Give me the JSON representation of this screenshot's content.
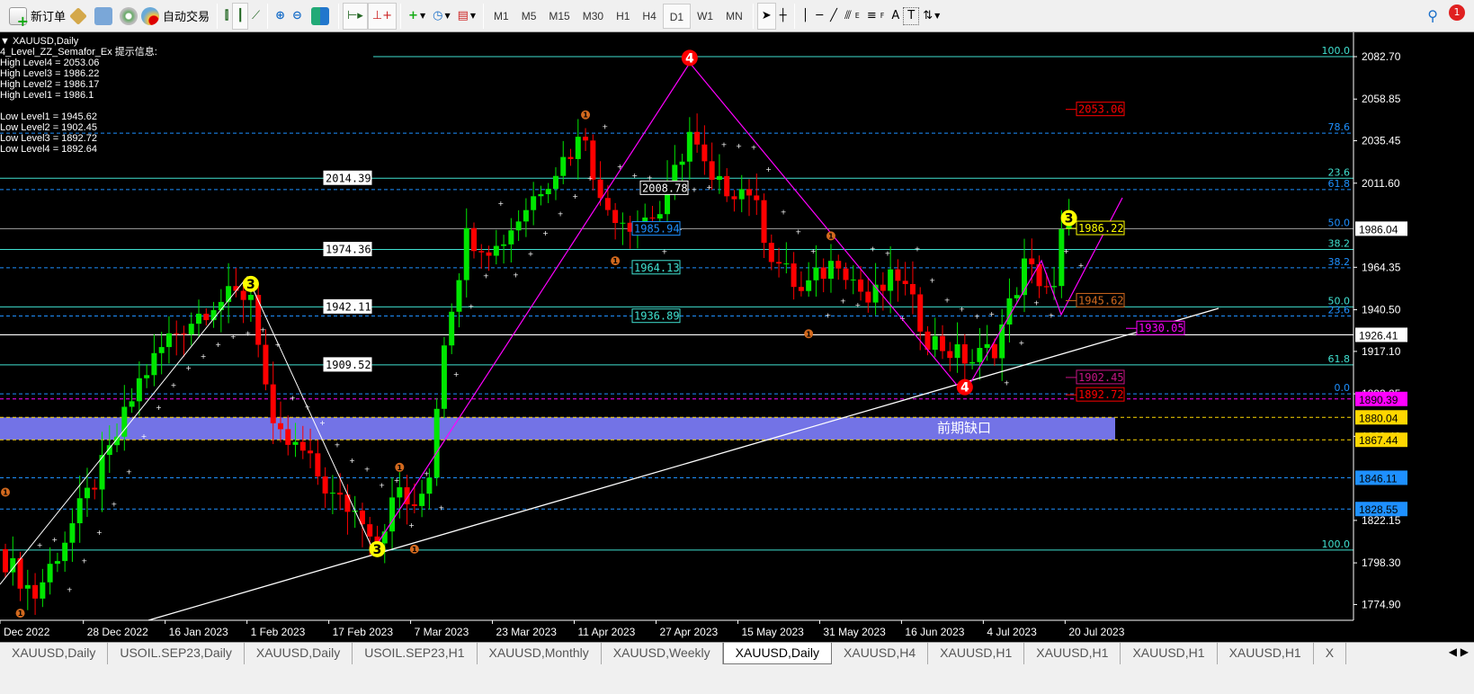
{
  "toolbar": {
    "new_order": "新订单",
    "auto_trading": "自动交易",
    "timeframes": [
      "M1",
      "M5",
      "M15",
      "M30",
      "H1",
      "H4",
      "D1",
      "W1",
      "MN"
    ],
    "active_timeframe": "D1",
    "notification_count": "1",
    "fib_fan_letter": "E",
    "fib_letter": "F",
    "text_letter": "A",
    "label_letter": "T"
  },
  "chart_window": {
    "symbol_title": "XAUUSD,Daily",
    "indicator_title": "4_Level_ZZ_Semafor_Ex 提示信息:",
    "info_lines": [
      "High Level4 = 2053.06",
      "High Level3 = 1986.22",
      "High Level2 = 1986.17",
      "High Level1 = 1986.1",
      "",
      "Low Level1 = 1945.62",
      "Low Level2 = 1902.45",
      "Low Level3 = 1892.72",
      "Low Level4 = 1892.64"
    ],
    "gap_label": "前期缺口"
  },
  "colors": {
    "bull": "#00e600",
    "bear": "#ff0000",
    "fib_solid": "#40e0d0",
    "fib_dashed": "#1e90ff",
    "magenta": "#ff00ff",
    "gold": "#ffd700",
    "gap": "#8080ff"
  },
  "chart_data": {
    "type": "candlestick",
    "symbol": "XAUUSD",
    "period": "Daily",
    "ylim": [
      1764,
      2095
    ],
    "price_ticks": [
      "2082.70",
      "2058.85",
      "2035.45",
      "2011.60",
      "1964.35",
      "1940.50",
      "1917.10",
      "1893.25",
      "1869.40",
      "1822.15",
      "1798.30",
      "1774.90"
    ],
    "date_ticks": [
      {
        "label": "Dec 2022",
        "bar": 0
      },
      {
        "label": "28 Dec 2022",
        "bar": 10
      },
      {
        "label": "16 Jan 2023",
        "bar": 21
      },
      {
        "label": "1 Feb 2023",
        "bar": 32
      },
      {
        "label": "17 Feb 2023",
        "bar": 43
      },
      {
        "label": "7 Mar 2023",
        "bar": 54
      },
      {
        "label": "23 Mar 2023",
        "bar": 65
      },
      {
        "label": "11 Apr 2023",
        "bar": 76
      },
      {
        "label": "27 Apr 2023",
        "bar": 87
      },
      {
        "label": "15 May 2023",
        "bar": 98
      },
      {
        "label": "31 May 2023",
        "bar": 109
      },
      {
        "label": "16 Jun 2023",
        "bar": 120
      },
      {
        "label": "4 Jul 2023",
        "bar": 131
      },
      {
        "label": "20 Jul 2023",
        "bar": 142
      }
    ],
    "close_keypoints": [
      [
        0,
        1800
      ],
      [
        4,
        1780
      ],
      [
        9,
        1820
      ],
      [
        14,
        1860
      ],
      [
        18,
        1900
      ],
      [
        22,
        1925
      ],
      [
        28,
        1945
      ],
      [
        33,
        1950
      ],
      [
        34,
        1925
      ],
      [
        36,
        1870
      ],
      [
        40,
        1860
      ],
      [
        44,
        1835
      ],
      [
        48,
        1825
      ],
      [
        50,
        1812
      ],
      [
        53,
        1840
      ],
      [
        55,
        1825
      ],
      [
        57,
        1850
      ],
      [
        59,
        1925
      ],
      [
        62,
        1982
      ],
      [
        66,
        1975
      ],
      [
        72,
        2010
      ],
      [
        76,
        2030
      ],
      [
        78,
        2040
      ],
      [
        80,
        2000
      ],
      [
        84,
        1990
      ],
      [
        88,
        1995
      ],
      [
        92,
        2040
      ],
      [
        95,
        2010
      ],
      [
        100,
        2008
      ],
      [
        103,
        1972
      ],
      [
        107,
        1950
      ],
      [
        112,
        1970
      ],
      [
        116,
        1945
      ],
      [
        120,
        1960
      ],
      [
        124,
        1925
      ],
      [
        128,
        1915
      ],
      [
        130,
        1912
      ],
      [
        133,
        1920
      ],
      [
        137,
        1965
      ],
      [
        139,
        1958
      ],
      [
        141,
        1950
      ],
      [
        142,
        1982
      ],
      [
        143,
        1986
      ]
    ],
    "price_boxes": [
      {
        "text": "1986.04",
        "price": 1986.04,
        "bg": "#ffffff",
        "fg": "#000000"
      },
      {
        "text": "1926.41",
        "price": 1926.41,
        "bg": "#ffffff",
        "fg": "#000000"
      },
      {
        "text": "1890.39",
        "price": 1890.39,
        "bg": "#ff00ff",
        "fg": "#000000"
      },
      {
        "text": "1880.04",
        "price": 1880.04,
        "bg": "#ffd700",
        "fg": "#000000"
      },
      {
        "text": "1867.44",
        "price": 1867.44,
        "bg": "#ffd700",
        "fg": "#000000"
      },
      {
        "text": "1846.11",
        "price": 1846.11,
        "bg": "#1e90ff",
        "fg": "#000000"
      },
      {
        "text": "1828.55",
        "price": 1828.55,
        "bg": "#1e90ff",
        "fg": "#000000"
      }
    ],
    "fib_levels": [
      {
        "label": "100.0",
        "price": 2082.7,
        "style": "solid",
        "color": "#40e0d0"
      },
      {
        "label": "78.6",
        "price": 2039.7,
        "style": "dashed",
        "color": "#1e90ff"
      },
      {
        "label": "23.6",
        "price": 2014.39,
        "style": "solid",
        "color": "#40e0d0"
      },
      {
        "label": "61.8",
        "price": 2008.0,
        "style": "dashed",
        "color": "#1e90ff"
      },
      {
        "label": "50.0",
        "price": 1986.04,
        "style": "solid",
        "color": "#a0a0a0"
      },
      {
        "label": "38.2",
        "price": 1974.36,
        "style": "solid",
        "color": "#40e0d0"
      },
      {
        "label": "38.2",
        "price": 1964.1,
        "style": "dashed",
        "color": "#1e90ff"
      },
      {
        "label": "50.0",
        "price": 1942.11,
        "style": "solid",
        "color": "#40e0d0"
      },
      {
        "label": "23.6",
        "price": 1937.0,
        "style": "dashed",
        "color": "#1e90ff"
      },
      {
        "label": "61.8",
        "price": 1909.52,
        "style": "solid",
        "color": "#40e0d0"
      },
      {
        "label": "0.0",
        "price": 1893.25,
        "style": "dashed",
        "color": "#1e90ff"
      },
      {
        "label": "100.0",
        "price": 1805.5,
        "style": "solid",
        "color": "#40e0d0"
      }
    ],
    "left_fib_boxes": [
      "2014.39",
      "1974.36",
      "1942.11",
      "1909.52"
    ],
    "mid_labels": [
      {
        "text": "2008.78",
        "color": "#ffffff"
      },
      {
        "text": "1985.94",
        "color": "#1e90ff"
      },
      {
        "text": "1964.13",
        "color": "#40e0d0"
      },
      {
        "text": "1936.89",
        "color": "#40e0d0"
      }
    ],
    "semafor_labels": [
      {
        "text": "2053.06",
        "color": "#ff0000"
      },
      {
        "text": "1986.22",
        "color": "#ffff00"
      },
      {
        "text": "1945.62",
        "color": "#d2691e"
      },
      {
        "text": "1930.05",
        "color": "#ff00ff"
      },
      {
        "text": "1902.45",
        "color": "#c71585"
      },
      {
        "text": "1892.72",
        "color": "#ff0000"
      }
    ],
    "semafor_points": [
      {
        "n": "3",
        "bar": 33,
        "price": 1955
      },
      {
        "n": "3",
        "bar": 50,
        "price": 1806
      },
      {
        "n": "3",
        "bar": 143,
        "price": 1992
      },
      {
        "n": "4",
        "bar": 92,
        "price": 2082
      },
      {
        "n": "4",
        "bar": 129,
        "price": 1897
      },
      {
        "n": "1",
        "bar": 0,
        "price": 1838
      },
      {
        "n": "1",
        "bar": 2,
        "price": 1770
      },
      {
        "n": "1",
        "bar": 53,
        "price": 1852
      },
      {
        "n": "1",
        "bar": 55,
        "price": 1806
      },
      {
        "n": "1",
        "bar": 78,
        "price": 2050
      },
      {
        "n": "1",
        "bar": 82,
        "price": 1968
      },
      {
        "n": "1",
        "bar": 111,
        "price": 1982
      },
      {
        "n": "1",
        "bar": 108,
        "price": 1927
      }
    ]
  },
  "tabs": {
    "items": [
      "XAUUSD,Daily",
      "USOIL.SEP23,Daily",
      "XAUUSD,Daily",
      "USOIL.SEP23,H1",
      "XAUUSD,Monthly",
      "XAUUSD,Weekly",
      "XAUUSD,Daily",
      "XAUUSD,H4",
      "XAUUSD,H1",
      "XAUUSD,H1",
      "XAUUSD,H1",
      "XAUUSD,H1",
      "X"
    ],
    "active_index": 6
  }
}
